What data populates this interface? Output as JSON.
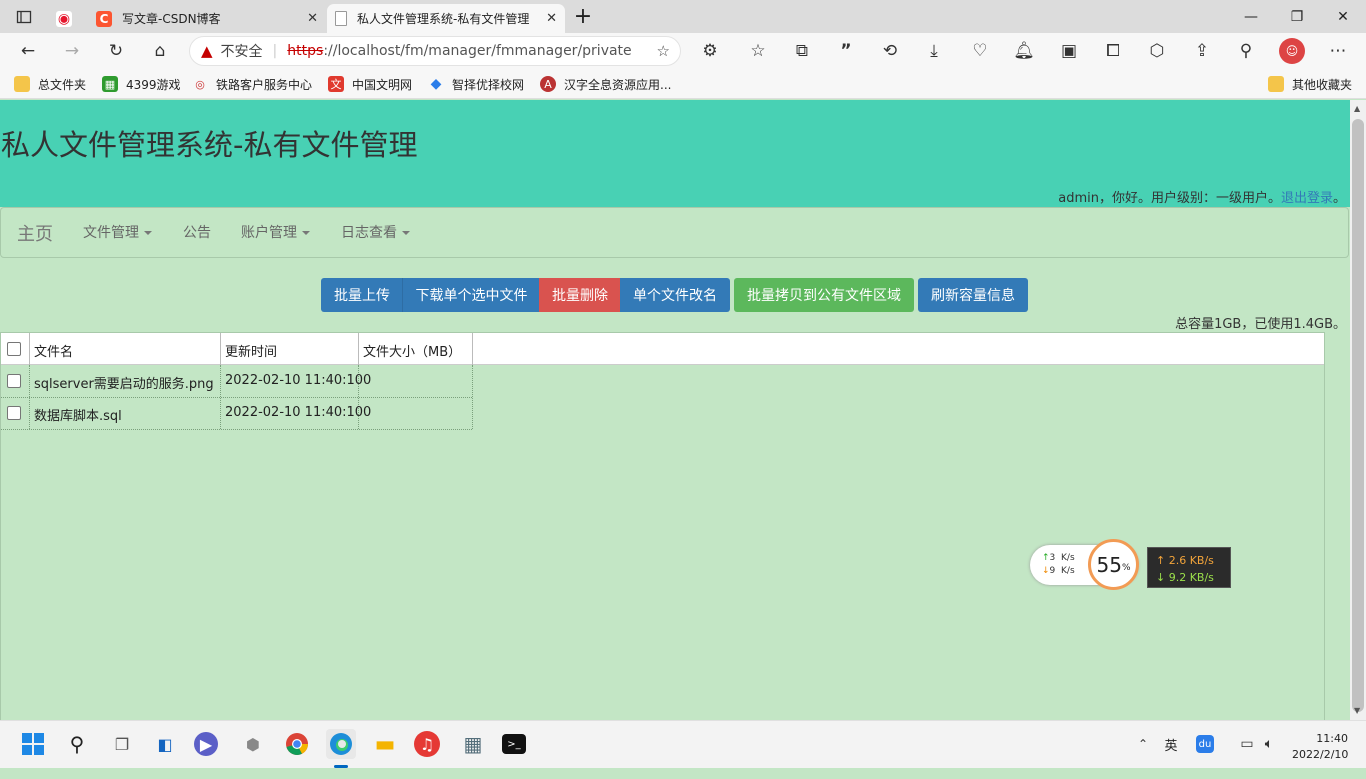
{
  "browser": {
    "tabs": [
      {
        "label": "",
        "icon": "weibo-icon"
      },
      {
        "label": "写文章-CSDN博客",
        "icon": "csdn-icon"
      },
      {
        "label": "私人文件管理系统-私有文件管理",
        "icon": "page-icon"
      }
    ],
    "security_label": "不安全",
    "url_scheme": "https",
    "url_rest": "://localhost/fm/manager/fmmanager/private",
    "bookmarks": [
      {
        "label": "总文件夹",
        "icon": "folder-icon"
      },
      {
        "label": "4399游戏",
        "icon": "game-icon"
      },
      {
        "label": "铁路客户服务中心",
        "icon": "railway-icon"
      },
      {
        "label": "中国文明网",
        "icon": "civilization-icon"
      },
      {
        "label": "智择优择校网",
        "icon": "school-icon"
      },
      {
        "label": "汉字全息资源应用...",
        "icon": "hanzi-icon"
      }
    ],
    "other_bookmarks": "其他收藏夹"
  },
  "page": {
    "title": "私人文件管理系统-私有文件管理",
    "user_text": "admin，你好。用户级别：一级用户。",
    "logout_label": "退出登录",
    "logout_suffix": "。",
    "nav": {
      "brand": "主页",
      "items": [
        {
          "label": "文件管理",
          "dropdown": true
        },
        {
          "label": "公告",
          "dropdown": false
        },
        {
          "label": "账户管理",
          "dropdown": true
        },
        {
          "label": "日志查看",
          "dropdown": true
        }
      ]
    },
    "actions": [
      {
        "label": "批量上传",
        "style": "blue"
      },
      {
        "label": "下载单个选中文件",
        "style": "blue"
      },
      {
        "label": "批量删除",
        "style": "red"
      },
      {
        "label": "单个文件改名",
        "style": "blue"
      },
      {
        "label": "批量拷贝到公有文件区域",
        "style": "green"
      },
      {
        "label": "刷新容量信息",
        "style": "blue"
      }
    ],
    "quota_text": "总容量1GB，已使用1.4GB。",
    "table": {
      "columns": [
        "文件名",
        "更新时间",
        "文件大小（MB）"
      ],
      "rows": [
        {
          "name": "sqlserver需要启动的服务.png",
          "time": "2022-02-10 11:40:10",
          "size": "0"
        },
        {
          "name": "数据库脚本.sql",
          "time": "2022-02-10 11:40:10",
          "size": "0"
        }
      ]
    }
  },
  "speed_widget": {
    "up_small": "3",
    "down_small": "9",
    "unit_small": "K/s",
    "percent": "55",
    "percent_sign": "%",
    "up_speed": "↑ 2.6 KB/s",
    "down_speed": "↓ 9.2 KB/s"
  },
  "taskbar": {
    "ime": "英",
    "time": "11:40",
    "date": "2022/2/10"
  }
}
